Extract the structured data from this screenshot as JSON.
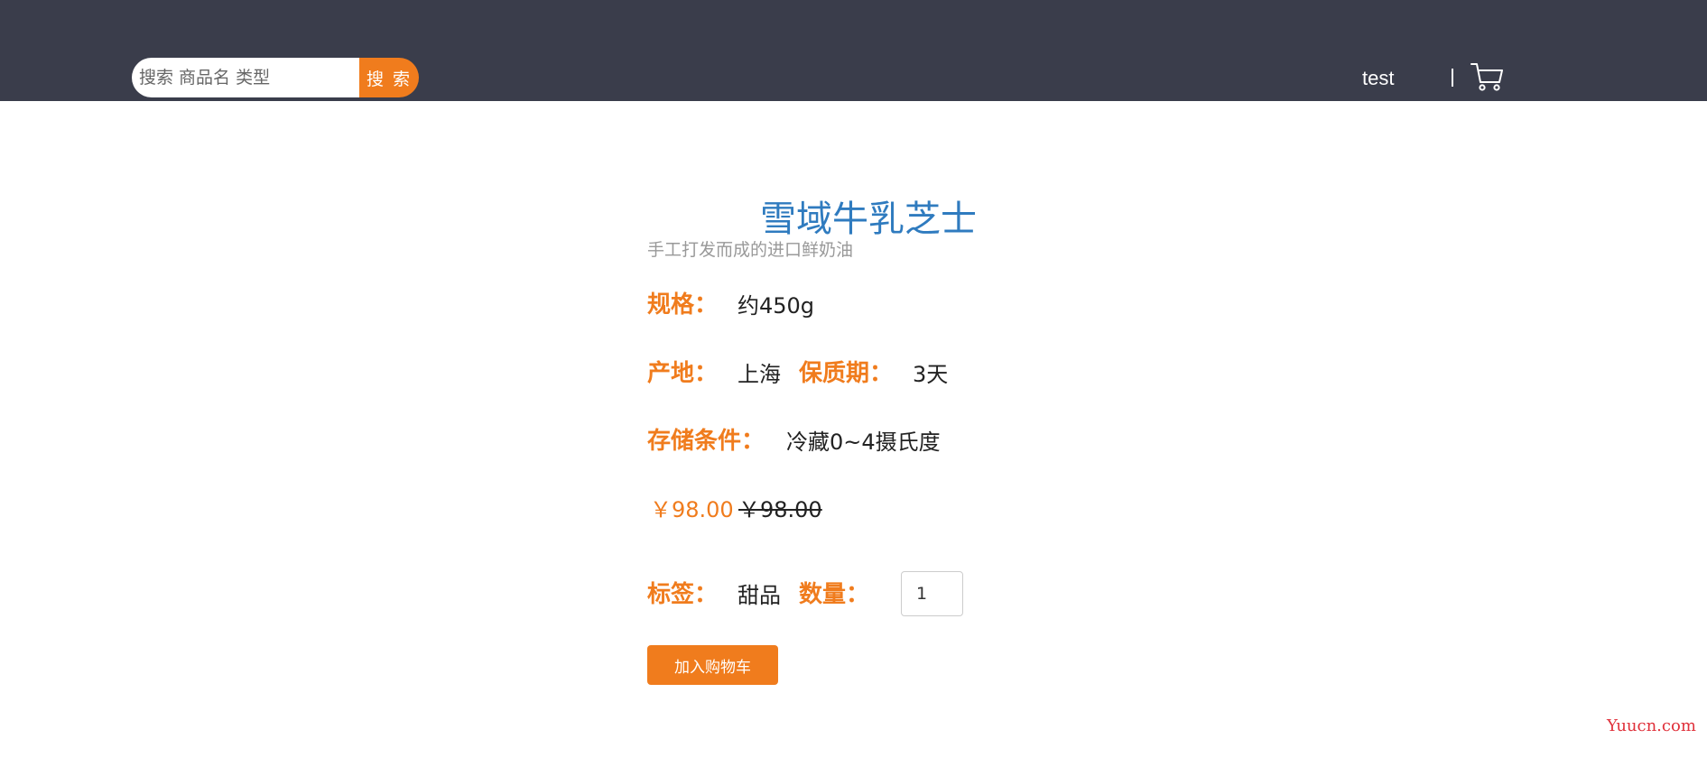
{
  "header": {
    "search_placeholder": "搜索 商品名 类型",
    "search_button": "搜 索",
    "username": "test",
    "cart_icon": "cart-icon"
  },
  "product": {
    "name": "雪域牛乳芝士",
    "description": "手工打发而成的进口鲜奶油",
    "spec_label": "规格：",
    "spec_value": "约450g",
    "origin_label": "产地：",
    "origin_value": "上海",
    "shelf_label": "保质期：",
    "shelf_value": "3天",
    "storage_label": "存储条件：",
    "storage_value": "冷藏0~4摄氏度",
    "price": "￥98.00",
    "original_price": "￥98.00",
    "tag_label": "标签：",
    "tag_value": "甜品",
    "qty_label": "数量：",
    "qty_value": "1",
    "add_to_cart": "加入购物车"
  },
  "watermark": "Yuucn.com",
  "colors": {
    "header_bg": "#3a3d4b",
    "accent": "#f07c1d",
    "title": "#2f7bbf"
  }
}
